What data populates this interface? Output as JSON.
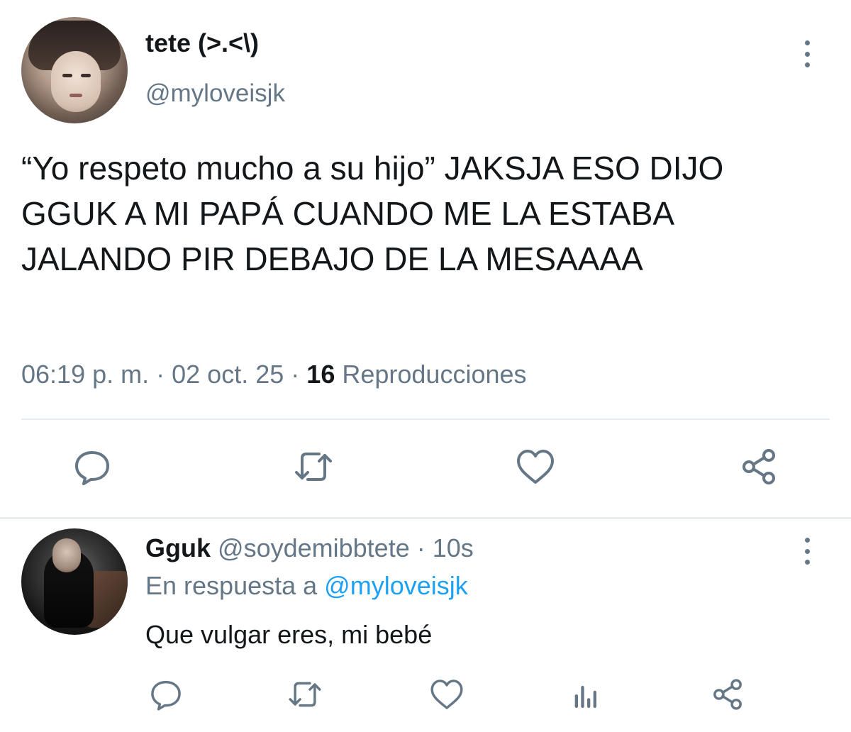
{
  "main_tweet": {
    "display_name": "tete (>.<\\)",
    "handle": "@myloveisjk",
    "text": "“Yo respeto mucho a su hijo” JAKSJA ESO DIJO GGUK A MI PAPÁ CUANDO ME LA ESTABA JALANDO PIR DEBAJO DE LA MESAAAA",
    "time": "06:19 p. m.",
    "separator": "·",
    "date": "02 oct. 25",
    "views_count": "16",
    "views_label": "Reproducciones",
    "avatar_icon": "profile-photo-icon",
    "actions": [
      "reply-icon",
      "retweet-icon",
      "like-icon",
      "share-icon"
    ]
  },
  "reply": {
    "display_name": "Gguk",
    "handle": "@soydemibbtete",
    "separator": "·",
    "time_ago": "10s",
    "reply_prefix": "En respuesta a",
    "reply_to": "@myloveisjk",
    "text": "Que vulgar eres, mi bebé",
    "avatar_icon": "profile-photo-icon",
    "actions": [
      "reply-icon",
      "retweet-icon",
      "like-icon",
      "analytics-icon",
      "share-icon"
    ]
  },
  "colors": {
    "primary_text": "#14171a",
    "secondary_text": "#657786",
    "accent": "#1da1f2",
    "divider": "#e6ecf0"
  }
}
